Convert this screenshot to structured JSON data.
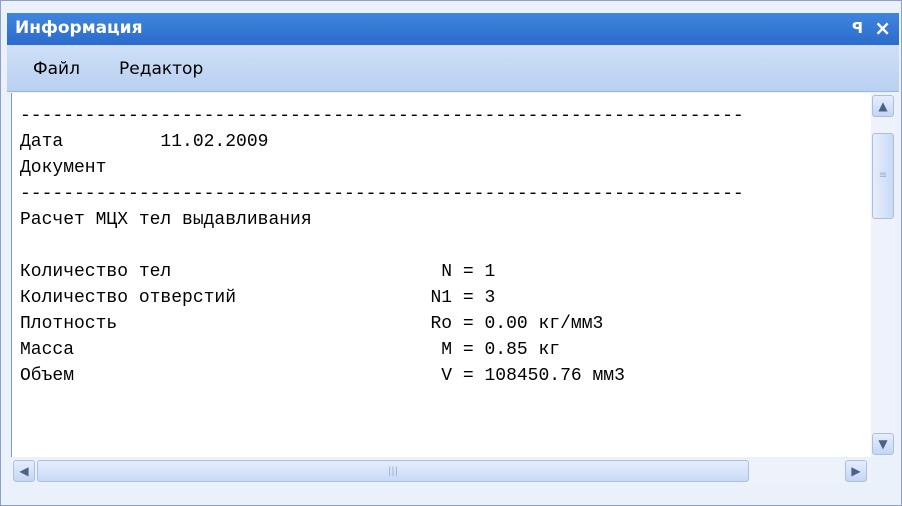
{
  "window": {
    "title": "Информация",
    "pin_glyph": "ᵖ",
    "close_glyph": "×"
  },
  "menu": {
    "items": [
      {
        "label": "Файл"
      },
      {
        "label": "Редактор"
      }
    ]
  },
  "report": {
    "lines": [
      "-------------------------------------------------------------------",
      "Дата         11.02.2009",
      "Документ",
      "-------------------------------------------------------------------",
      "Расчет МЦХ тел выдавливания",
      "",
      "Количество тел                         N = 1",
      "Количество отверстий                  N1 = 3",
      "Плотность                             Ro = 0.00 кг/мм3",
      "Масса                                  M = 0.85 кг",
      "Объем                                  V = 108450.76 мм3"
    ]
  },
  "icons": {
    "scroll_up": "chevron-up-icon",
    "scroll_down": "chevron-down-icon",
    "scroll_left": "chevron-left-icon",
    "scroll_right": "chevron-right-icon"
  },
  "colors": {
    "titlebar": "#2c6bcc",
    "menubar": "#c4d8f4",
    "text": "#000000"
  }
}
